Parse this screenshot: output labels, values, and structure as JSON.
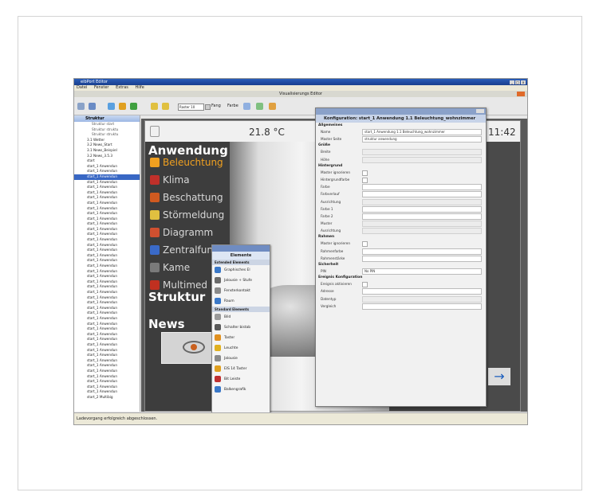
{
  "window": {
    "title": "eibPort Editor",
    "controls": [
      "_",
      "□",
      "x"
    ]
  },
  "menu": [
    "Datei",
    "Fenster",
    "Extras",
    "Hilfe"
  ],
  "vis_title": "Visualisierungs Editor",
  "toolbar": {
    "raster": "Raster 10",
    "fang": "Fang",
    "farbe": "Farbe"
  },
  "tree": {
    "title": "Struktur",
    "items": [
      {
        "label": "Struktur start",
        "indent": 1
      },
      {
        "label": "Struktur struktu",
        "indent": 1
      },
      {
        "label": "Struktur struktu",
        "indent": 1
      },
      {
        "label": "3.1 Wetter",
        "indent": 0
      },
      {
        "label": "3.2 News_Start",
        "indent": 0
      },
      {
        "label": "3.1 News_Beispiel",
        "indent": 0
      },
      {
        "label": "3.2 News_3.5.3",
        "indent": 0
      },
      {
        "label": "start",
        "indent": 0
      },
      {
        "label": "start_1 Anwendun",
        "indent": 0
      },
      {
        "label": "start_1 Anwendun",
        "indent": 0
      },
      {
        "label": "start_1 Anwendun",
        "indent": 0,
        "selected": true
      },
      {
        "label": "start_1 Anwendun",
        "indent": 0
      },
      {
        "label": "start_1 Anwendun",
        "indent": 0
      },
      {
        "label": "start_1 Anwendun",
        "indent": 0
      },
      {
        "label": "start_1 Anwendun",
        "indent": 0
      },
      {
        "label": "start_1 Anwendun",
        "indent": 0
      },
      {
        "label": "start_1 Anwendun",
        "indent": 0
      },
      {
        "label": "start_1 Anwendun",
        "indent": 0
      },
      {
        "label": "start_1 Anwendun",
        "indent": 0
      },
      {
        "label": "start_1 Anwendun",
        "indent": 0
      },
      {
        "label": "start_1 Anwendun",
        "indent": 0
      },
      {
        "label": "start_1 Anwendun",
        "indent": 0
      },
      {
        "label": "start_1 Anwendun",
        "indent": 0
      },
      {
        "label": "start_1 Anwendun",
        "indent": 0
      },
      {
        "label": "start_1 Anwendun",
        "indent": 0
      },
      {
        "label": "start_1 Anwendun",
        "indent": 0
      },
      {
        "label": "start_1 Anwendun",
        "indent": 0
      },
      {
        "label": "start_1 Anwendun",
        "indent": 0
      },
      {
        "label": "start_1 Anwendun",
        "indent": 0
      },
      {
        "label": "start_1 Anwendun",
        "indent": 0
      },
      {
        "label": "start_1 Anwendun",
        "indent": 0
      },
      {
        "label": "start_1 Anwendun",
        "indent": 0
      },
      {
        "label": "start_1 Anwendun",
        "indent": 0
      },
      {
        "label": "start_1 Anwendun",
        "indent": 0
      },
      {
        "label": "start_1 Anwendun",
        "indent": 0
      },
      {
        "label": "start_1 Anwendun",
        "indent": 0
      },
      {
        "label": "start_1 Anwendun",
        "indent": 0
      },
      {
        "label": "start_1 Anwendun",
        "indent": 0
      },
      {
        "label": "start_1 Anwendun",
        "indent": 0
      },
      {
        "label": "start_1 Anwendun",
        "indent": 0
      },
      {
        "label": "start_1 Anwendun",
        "indent": 0
      },
      {
        "label": "start_1 Anwendun",
        "indent": 0
      },
      {
        "label": "start_1 Anwendun",
        "indent": 0
      },
      {
        "label": "start_1 Anwendun",
        "indent": 0
      },
      {
        "label": "start_1 Anwendun",
        "indent": 0
      },
      {
        "label": "start_1 Anwendun",
        "indent": 0
      },
      {
        "label": "start_1 Anwendun",
        "indent": 0
      },
      {
        "label": "start_1 Anwendun",
        "indent": 0
      },
      {
        "label": "start_1 Anwendun",
        "indent": 0
      },
      {
        "label": "start_1 Anwendun",
        "indent": 0
      },
      {
        "label": "start_1 Anwendun",
        "indent": 0
      },
      {
        "label": "start_1 Anwendun",
        "indent": 0
      },
      {
        "label": "start_2 Multibig",
        "indent": 0
      }
    ]
  },
  "visu": {
    "temperature": "21.8 °C",
    "time": "11:42",
    "section_anwendung": "Anwendung",
    "section_struktur": "Struktur",
    "section_news": "News",
    "menu_items": [
      {
        "label": "Beleuchtung",
        "color": "#f0a020",
        "highlight": true
      },
      {
        "label": "Klima",
        "color": "#c0302a"
      },
      {
        "label": "Beschattung",
        "color": "#d05a20"
      },
      {
        "label": "Störmeldung",
        "color": "#e0c040"
      },
      {
        "label": "Diagramm",
        "color": "#d05030"
      },
      {
        "label": "Zentralfun",
        "color": "#3a6ac8"
      },
      {
        "label": "Kame",
        "color": "#7a7a7a"
      },
      {
        "label": "Multimed",
        "color": "#c03020"
      }
    ]
  },
  "palette": {
    "title": "Elemente",
    "section_extended": "Extended Elements",
    "extended": [
      {
        "label": "Graphisches El",
        "color": "#3a78c8"
      },
      {
        "label": "Jalousie + Stufe",
        "color": "#6a6a6a"
      },
      {
        "label": "Fensterkontakt",
        "color": "#8a8a8a"
      },
      {
        "label": "Raum",
        "color": "#3a78c8"
      }
    ],
    "section_standard": "Standard Elements",
    "standard": [
      {
        "label": "Bild",
        "color": "#9a9a9a"
      },
      {
        "label": "Schalter bistab",
        "color": "#5a5a5a"
      },
      {
        "label": "Taster",
        "color": "#e09020"
      },
      {
        "label": "Leuchte",
        "color": "#e0b020"
      },
      {
        "label": "Jalousie",
        "color": "#8a8a8a"
      },
      {
        "label": "EIS 14 Taster",
        "color": "#e0a020"
      },
      {
        "label": "Bit Leiste",
        "color": "#c03030"
      },
      {
        "label": "Balkengrafik",
        "color": "#3a78c8"
      }
    ]
  },
  "config": {
    "title": "Konfiguration: start_1 Anwendung 1.1 Beleuchtung_wohnzimmer",
    "sections": [
      {
        "name": "Allgemeines",
        "rows": [
          {
            "label": "Name",
            "value": "start_1 Anwendung 1.1 Beleuchtung_wohnzimmer",
            "type": "text"
          },
          {
            "label": "Master Seite",
            "value": "struktur anwendung",
            "type": "select"
          }
        ]
      },
      {
        "name": "Größe",
        "rows": [
          {
            "label": "Breite",
            "value": "",
            "type": "disabled"
          },
          {
            "label": "Höhe",
            "value": "",
            "type": "disabled"
          }
        ]
      },
      {
        "name": "Hintergrund",
        "rows": [
          {
            "label": "Master ignorieren",
            "type": "check"
          },
          {
            "label": "Hintergrundfarbe",
            "type": "check"
          },
          {
            "label": "Farbe",
            "value": "",
            "type": "empty"
          },
          {
            "label": "Farbverlauf",
            "value": "",
            "type": "empty"
          },
          {
            "label": "Ausrichtung",
            "value": "",
            "type": "disabled"
          },
          {
            "label": "Farbe 1",
            "value": "",
            "type": "empty"
          },
          {
            "label": "Farbe 2",
            "value": "",
            "type": "empty"
          },
          {
            "label": "Muster",
            "value": "",
            "type": "disabled"
          },
          {
            "label": "Ausrichtung",
            "value": "",
            "type": "disabled"
          }
        ]
      },
      {
        "name": "Rahmen",
        "rows": [
          {
            "label": "Master ignorieren",
            "type": "check"
          },
          {
            "label": "Rahmenfarbe",
            "value": "",
            "type": "empty"
          },
          {
            "label": "Rahmenstärke",
            "value": "",
            "type": "empty"
          }
        ]
      },
      {
        "name": "Sicherheit",
        "rows": [
          {
            "label": "PIN",
            "value": "No PIN",
            "type": "select"
          }
        ]
      },
      {
        "name": "Ereignis Konfiguration",
        "rows": [
          {
            "label": "Ereignis aktivieren",
            "type": "check"
          },
          {
            "label": "Adresse",
            "value": "",
            "type": "empty"
          },
          {
            "label": "Datentyp",
            "value": "",
            "type": "disabled"
          },
          {
            "label": "Vergleich",
            "value": "",
            "type": "empty"
          }
        ]
      }
    ]
  },
  "status": "Ladevorgang erfolgreich abgeschlossen."
}
